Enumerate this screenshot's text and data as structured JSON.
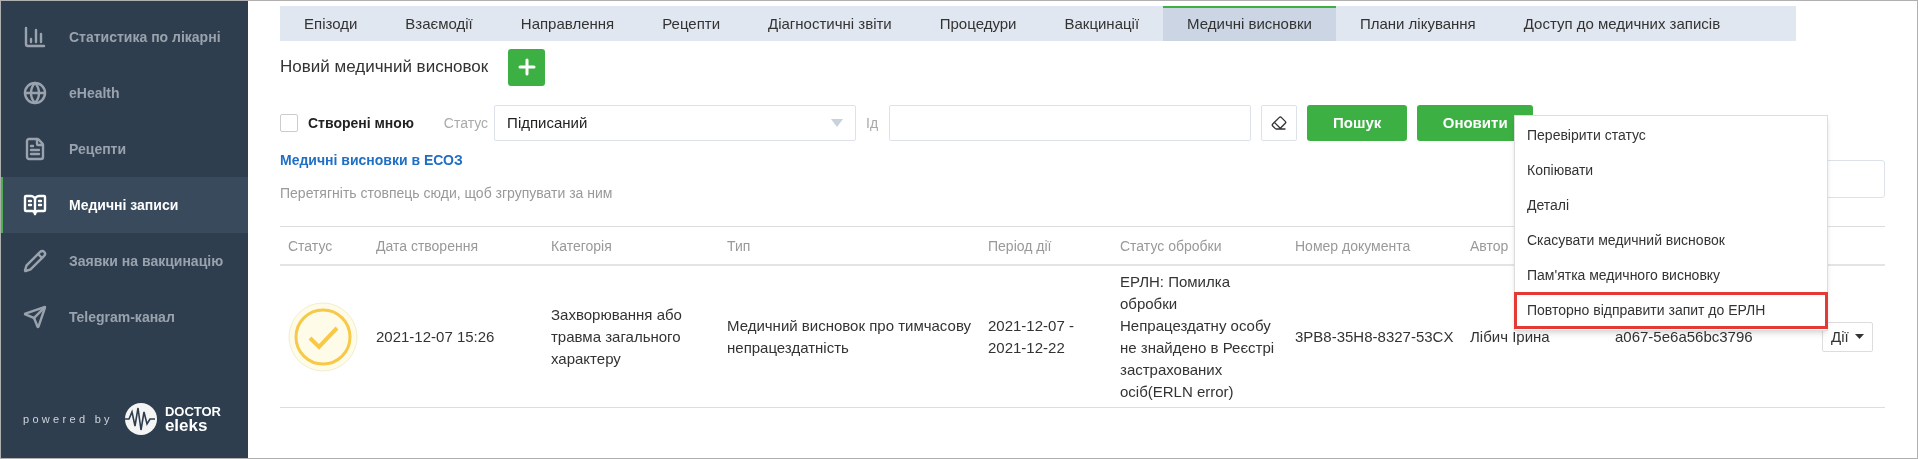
{
  "sidebar": {
    "items": [
      {
        "label": "Статистика по лікарні",
        "selected": false
      },
      {
        "label": "eHealth",
        "selected": false
      },
      {
        "label": "Рецепти",
        "selected": false
      },
      {
        "label": "Медичні записи",
        "selected": true
      },
      {
        "label": "Заявки на вакцинацію",
        "selected": false
      },
      {
        "label": "Telegram-канал",
        "selected": false
      }
    ],
    "footer": {
      "powered": "powered by",
      "logo_top": "DOCTOR",
      "logo_bottom": "eleks"
    }
  },
  "tabs": [
    {
      "label": "Епізоди",
      "selected": false
    },
    {
      "label": "Взаємодії",
      "selected": false
    },
    {
      "label": "Направлення",
      "selected": false
    },
    {
      "label": "Рецепти",
      "selected": false
    },
    {
      "label": "Діагностичні звіти",
      "selected": false
    },
    {
      "label": "Процедури",
      "selected": false
    },
    {
      "label": "Вакцинації",
      "selected": false
    },
    {
      "label": "Медичні висновки",
      "selected": true
    },
    {
      "label": "Плани лікування",
      "selected": false
    },
    {
      "label": "Доступ до медичних записів",
      "selected": false
    }
  ],
  "new_title": "Новий медичний висновок",
  "filters": {
    "mine": {
      "label": "Створені мною",
      "checked": false
    },
    "status_label": "Статус",
    "status_value": "Підписаний",
    "id_label": "Ід",
    "search_button": "Пошук",
    "refresh_button": "Оновити"
  },
  "section_link": "Медичні висновки в ЕСОЗ",
  "group_hint": "Перетягніть стовпець сюди, щоб згрупувати за ним",
  "table": {
    "columns": [
      "Статус",
      "Дата створення",
      "Категорія",
      "Тип",
      "Період дії",
      "Статус обробки",
      "Номер документа",
      "Автор"
    ],
    "rows": [
      {
        "cells": [
          "",
          "2021-12-07 15:26",
          "Захворювання або травма загального характеру",
          "Медичний висновок про тимчасову непрацездатність",
          "2021-12-07 - 2021-12-22",
          "ЕРЛН: Помилка обробки Непрацездатну особу не знайдено в Реєстрі застрахованих осіб(ERLN error)",
          "3PB8-35H8-8327-53CX",
          "Лібич Ірина",
          "a067-5e6a56bc3796"
        ],
        "actions": "Дії"
      }
    ]
  },
  "menu": [
    {
      "label": "Перевірити статус",
      "highlighted": false
    },
    {
      "label": "Копіювати",
      "highlighted": false
    },
    {
      "label": "Деталі",
      "highlighted": false
    },
    {
      "label": "Скасувати медичний висновок",
      "highlighted": false
    },
    {
      "label": "Пам'ятка медичного висновку",
      "highlighted": false
    },
    {
      "label": "Повторно відправити запит до ЕРЛН",
      "highlighted": true
    }
  ]
}
